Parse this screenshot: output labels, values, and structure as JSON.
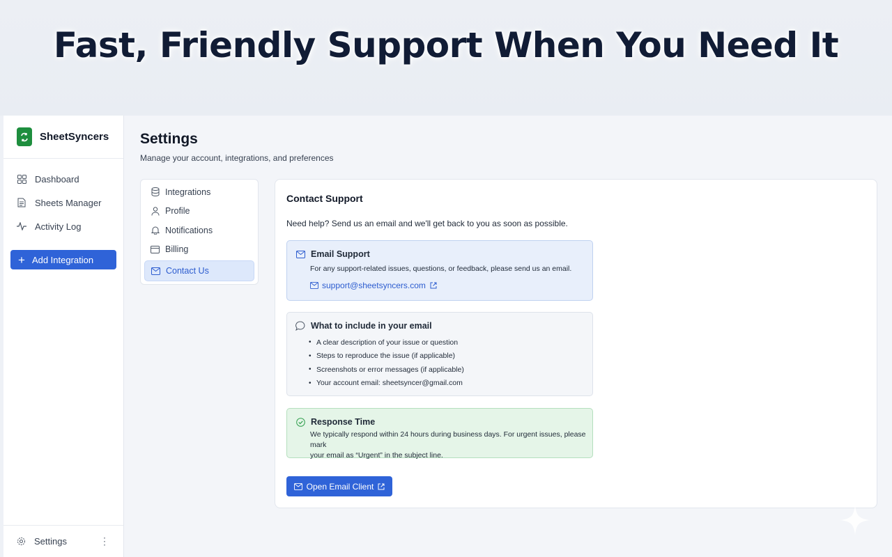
{
  "hero": {
    "title": "Fast, Friendly Support When You Need It"
  },
  "brand": {
    "name": "SheetSyncers",
    "color": "#1e8e3e"
  },
  "sidebar": {
    "items": [
      {
        "label": "Dashboard",
        "icon": "grid-icon"
      },
      {
        "label": "Sheets Manager",
        "icon": "document-icon"
      },
      {
        "label": "Activity Log",
        "icon": "activity-icon"
      }
    ],
    "add_button": "Add Integration",
    "footer": {
      "label": "Settings",
      "icon": "gear-icon",
      "menu": "⋮"
    }
  },
  "page": {
    "title": "Settings",
    "subtitle": "Manage your account, integrations, and preferences"
  },
  "subnav": {
    "items": [
      {
        "label": "Integrations",
        "icon": "database-icon"
      },
      {
        "label": "Profile",
        "icon": "user-icon"
      },
      {
        "label": "Notifications",
        "icon": "bell-icon"
      },
      {
        "label": "Billing",
        "icon": "credit-card-icon"
      },
      {
        "label": "Contact Us",
        "icon": "mail-icon",
        "active": true
      }
    ]
  },
  "contact": {
    "title": "Contact Support",
    "intro": "Need help? Send us an email and we'll get back to you as soon as possible.",
    "email_box": {
      "title": "Email Support",
      "text": "For any support-related issues, questions, or feedback, please send us an email.",
      "email": "support@sheetsyncers.com"
    },
    "include_box": {
      "title": "What to include in your email",
      "items": [
        "A clear description of your issue or question",
        "Steps to reproduce the issue (if applicable)",
        "Screenshots or error messages (if applicable)",
        "Your account email: sheetsyncer@gmail.com"
      ]
    },
    "response_box": {
      "title": "Response Time",
      "text_line1": "We typically respond within 24 hours during business days. For urgent issues, please mark",
      "text_line2": "your email as “Urgent” in the subject line."
    },
    "open_button": "Open Email Client"
  },
  "colors": {
    "accent": "#2f63d8",
    "email_box_bg": "#e8effb",
    "response_box_bg": "#e5f5e8"
  }
}
